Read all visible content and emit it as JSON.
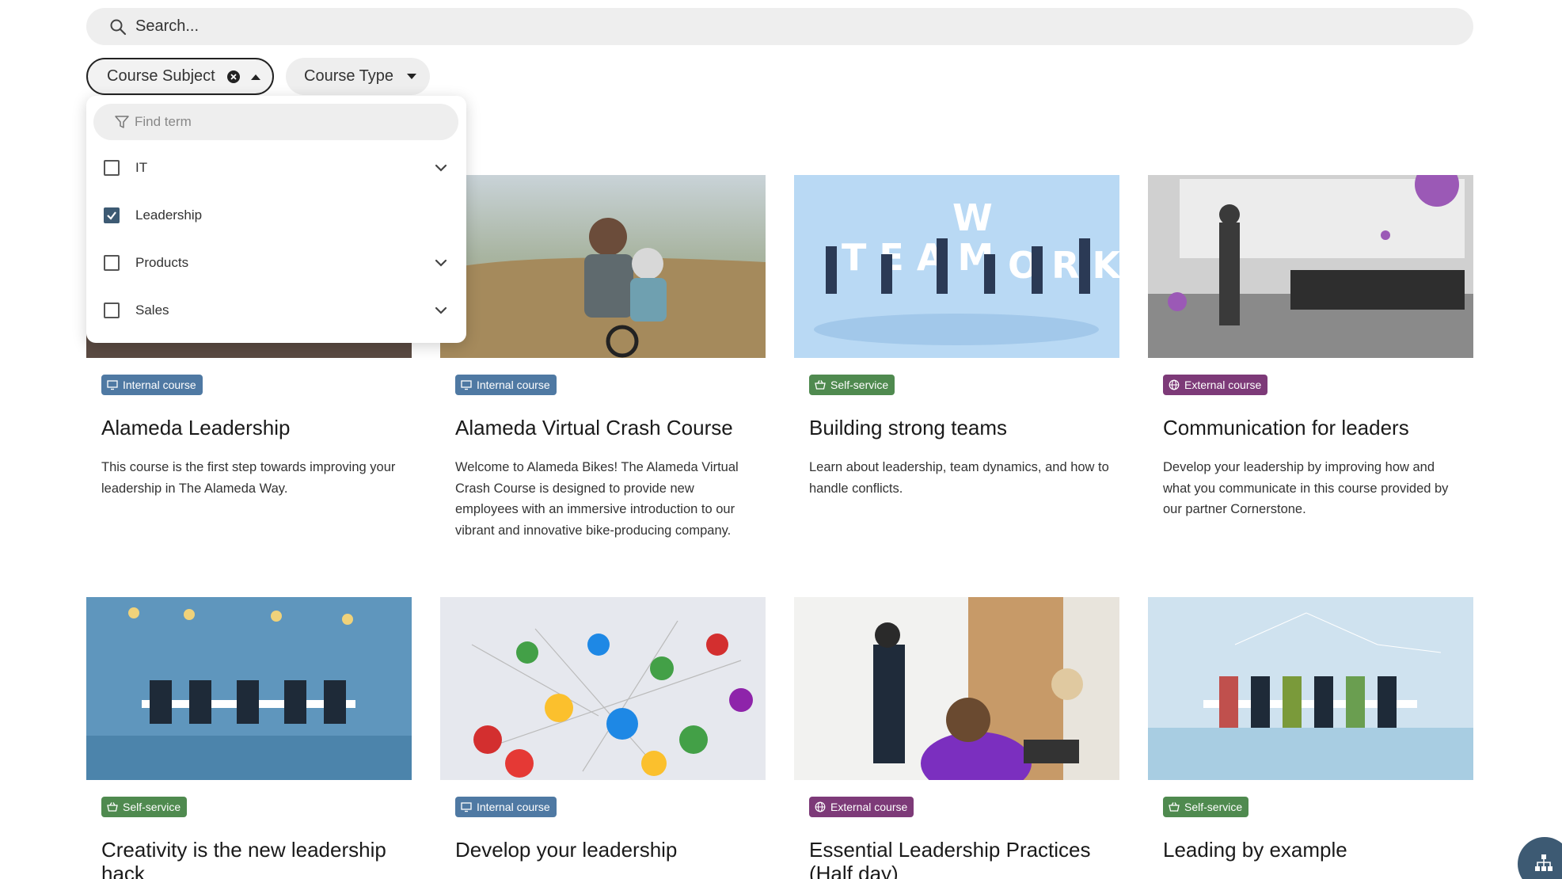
{
  "search": {
    "placeholder": "Search..."
  },
  "filters": {
    "subject_label": "Course Subject",
    "type_label": "Course Type"
  },
  "dropdown": {
    "find_placeholder": "Find term",
    "options": [
      {
        "label": "IT",
        "checked": false,
        "expandable": true
      },
      {
        "label": "Leadership",
        "checked": true,
        "expandable": false
      },
      {
        "label": "Products",
        "checked": false,
        "expandable": true
      },
      {
        "label": "Sales",
        "checked": false,
        "expandable": true
      }
    ]
  },
  "colors": {
    "internal": "#4f79a3",
    "self_service": "#4f8a4f",
    "external": "#7d3a78",
    "accent": "#3d5a73"
  },
  "cards": [
    {
      "badge": "Internal course",
      "badge_icon": "monitor-icon",
      "title": "Alameda Leadership",
      "description": "This course is the first step towards improving your leadership in The Alameda Way."
    },
    {
      "badge": "Internal course",
      "badge_icon": "monitor-icon",
      "title": "Alameda Virtual Crash Course",
      "description": "Welcome to Alameda Bikes! The Alameda Virtual Crash Course is designed to provide new employees with an immersive introduction to our vibrant and innovative bike-producing company."
    },
    {
      "badge": "Self-service",
      "badge_icon": "basket-icon",
      "title": "Building strong teams",
      "description": "Learn about leadership, team dynamics, and how to handle conflicts."
    },
    {
      "badge": "External course",
      "badge_icon": "globe-icon",
      "title": "Communication for leaders",
      "description": "Develop your leadership by improving how and what you communicate in this course provided by our partner Cornerstone."
    },
    {
      "badge": "Self-service",
      "badge_icon": "basket-icon",
      "title": "Creativity is the new leadership hack",
      "description": ""
    },
    {
      "badge": "Internal course",
      "badge_icon": "monitor-icon",
      "title": "Develop your leadership",
      "description": ""
    },
    {
      "badge": "External course",
      "badge_icon": "globe-icon",
      "title": "Essential Leadership Practices (Half day)",
      "description": ""
    },
    {
      "badge": "Self-service",
      "badge_icon": "basket-icon",
      "title": "Leading by example",
      "description": ""
    }
  ]
}
